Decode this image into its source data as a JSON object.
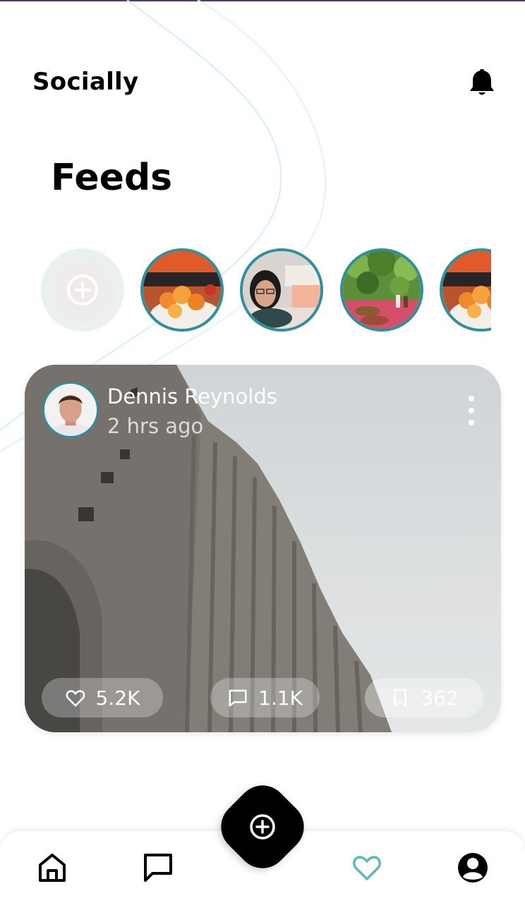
{
  "header": {
    "app_title": "Socially",
    "notification_icon": "bell-icon"
  },
  "feeds": {
    "title": "Feeds"
  },
  "stories": {
    "add_icon": "plus-circle-icon",
    "items": [
      {
        "subject": "food-plate"
      },
      {
        "subject": "person-selfie"
      },
      {
        "subject": "garden-table"
      },
      {
        "subject": "food-plate"
      }
    ]
  },
  "post": {
    "author_name": "Dennis Reynolds",
    "time": "2 hrs ago",
    "likes": "5.2K",
    "comments": "1.1K",
    "saves": "362",
    "menu_icon": "more-vertical-icon"
  },
  "nav": {
    "items": [
      "home-icon",
      "chat-icon",
      "add-post-icon",
      "heart-icon",
      "profile-icon"
    ],
    "active": "heart-icon",
    "accent": "#5fb7bf"
  },
  "colors": {
    "ring": "#2f8f9d",
    "fab": "#000000"
  }
}
